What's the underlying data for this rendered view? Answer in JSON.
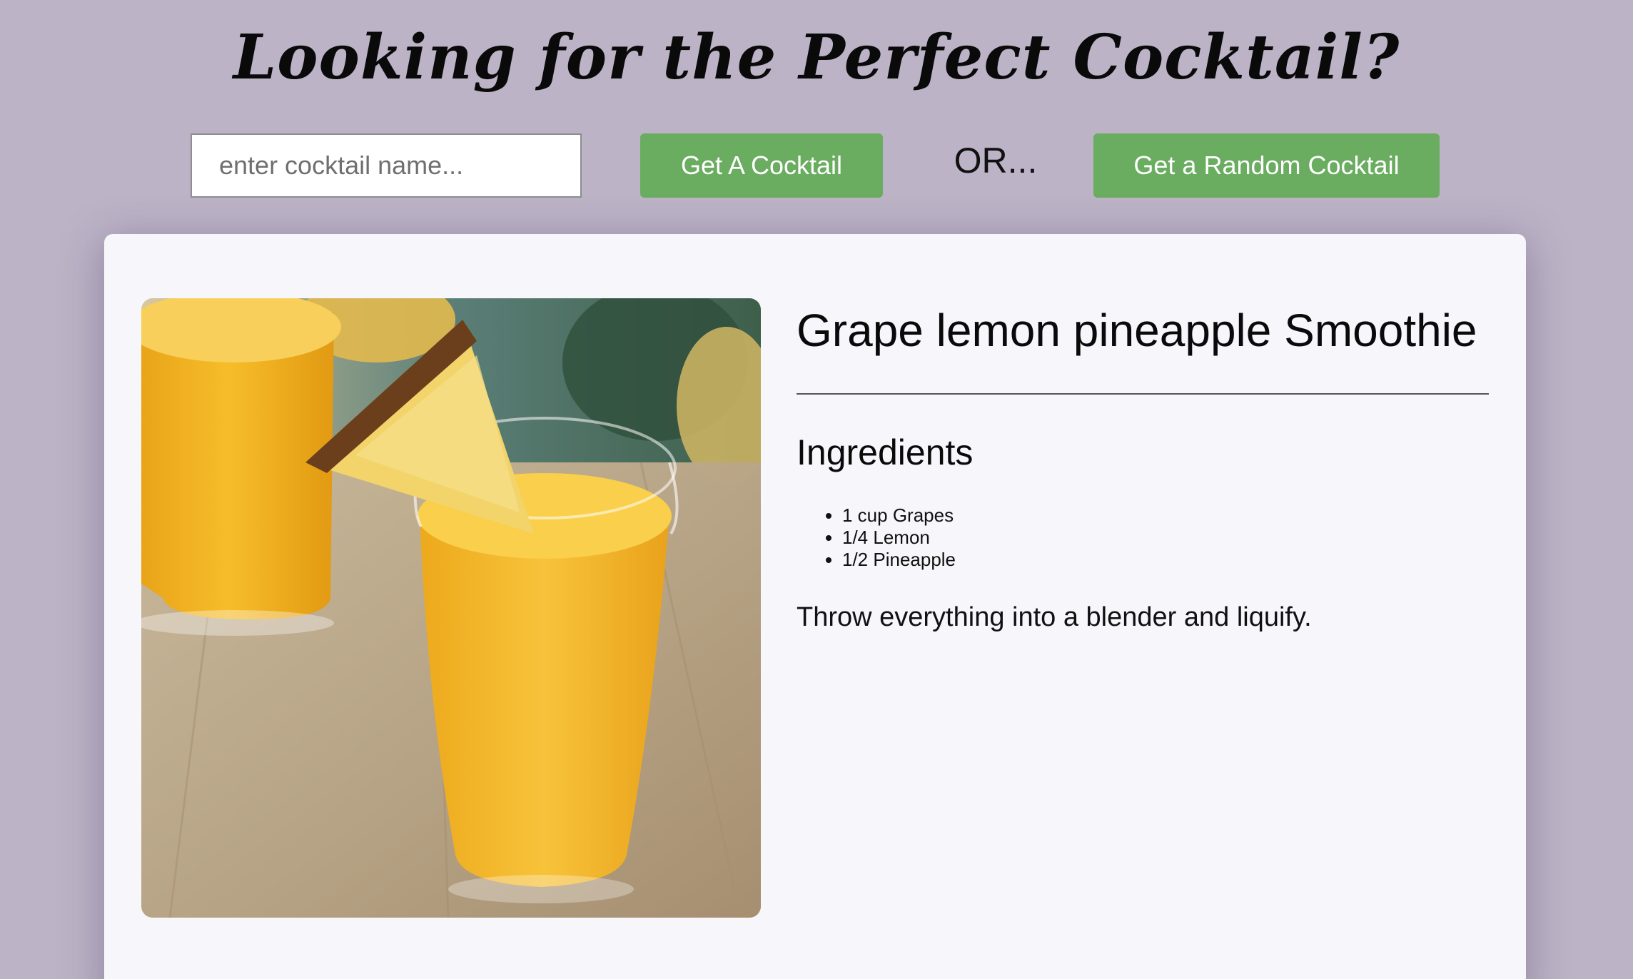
{
  "header": {
    "title": "Looking for the Perfect Cocktail?"
  },
  "search": {
    "placeholder": "enter cocktail name...",
    "value": ""
  },
  "actions": {
    "get_label": "Get A Cocktail",
    "or_label": "OR...",
    "random_label": "Get a Random Cocktail",
    "button_color": "#6aac60"
  },
  "cocktail": {
    "name": "Grape lemon pineapple Smoothie",
    "image_subject": "two glasses of yellow pineapple smoothie with a pineapple wedge garnish on a wooden table",
    "ingredients_heading": "Ingredients",
    "ingredients": [
      "1 cup Grapes",
      "1/4 Lemon",
      "1/2 Pineapple"
    ],
    "instructions": "Throw everything into a blender and liquify."
  },
  "colors": {
    "background": "#bcb3c7",
    "card": "#f7f7fb",
    "accent": "#6aac60"
  }
}
